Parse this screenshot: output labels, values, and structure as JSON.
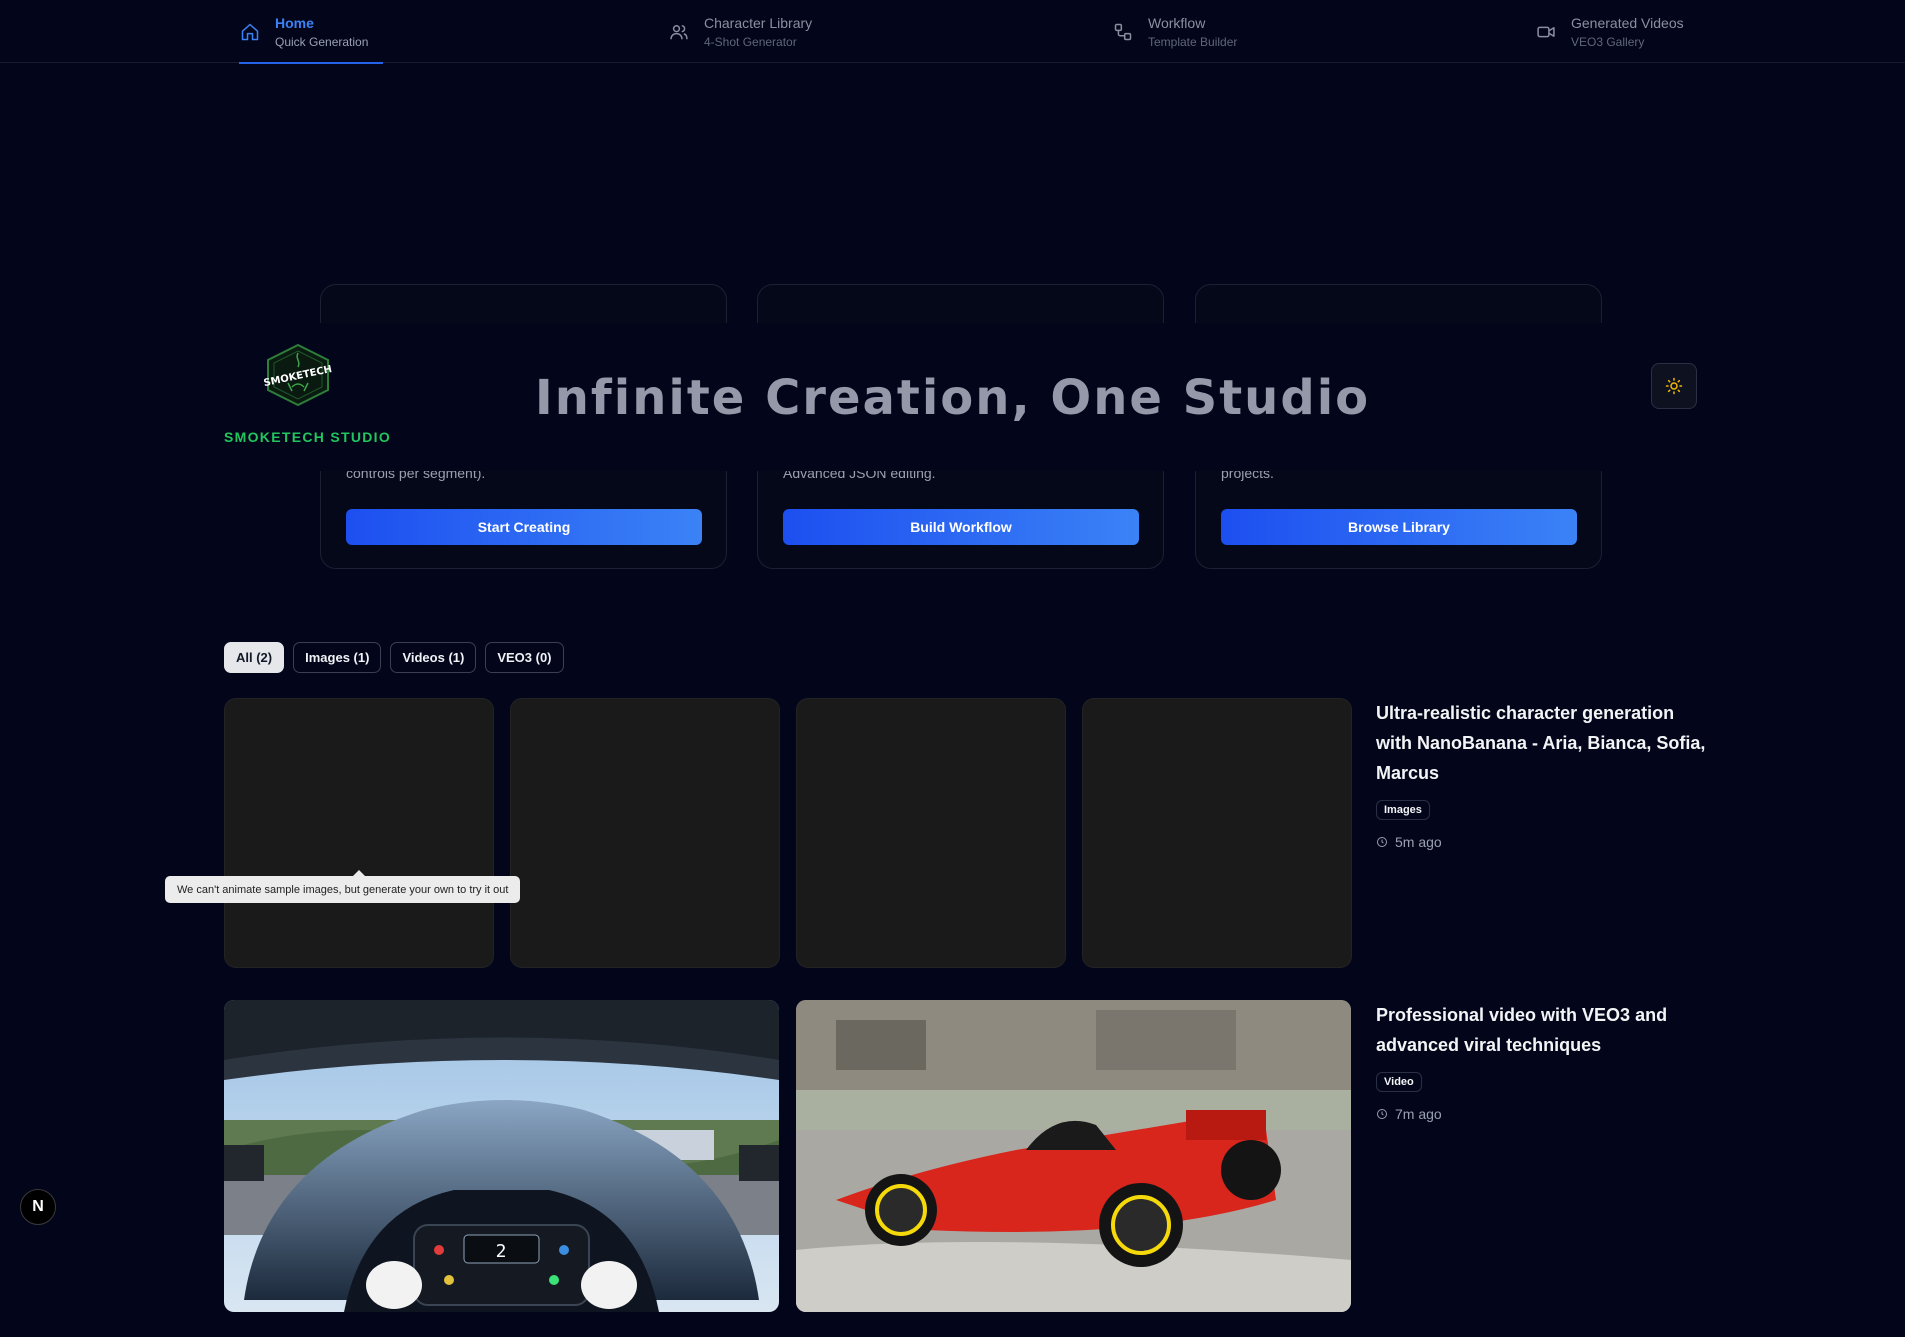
{
  "nav": [
    {
      "label": "Home",
      "sub": "Quick Generation",
      "icon": "home-icon",
      "active": true
    },
    {
      "label": "Character Library",
      "sub": "4-Shot Generator",
      "icon": "users-icon"
    },
    {
      "label": "Workflow",
      "sub": "Template Builder",
      "icon": "workflow-icon"
    },
    {
      "label": "Generated Videos",
      "sub": "VEO3 Gallery",
      "icon": "video-icon"
    }
  ],
  "brand": {
    "name": "SMOKETECH STUDIO",
    "logo_text": "SMOKETECH",
    "color": "#22c55e"
  },
  "hero": {
    "title": "Infinite Creation, One Studio"
  },
  "cards": [
    {
      "desc": "controls per segment).",
      "cta": "Start Creating"
    },
    {
      "desc": "Advanced JSON editing.",
      "cta": "Build Workflow"
    },
    {
      "desc": "projects.",
      "cta": "Browse Library"
    }
  ],
  "filters": [
    {
      "label": "All (2)",
      "active": true
    },
    {
      "label": "Images (1)"
    },
    {
      "label": "Videos (1)"
    },
    {
      "label": "VEO3 (0)"
    }
  ],
  "entries": [
    {
      "title": "Ultra-realistic character generation with NanoBanana - Aria, Bianca, Sofia, Marcus",
      "badge": "Images",
      "time": "5m ago"
    },
    {
      "title": "Professional video with VEO3 and advanced viral techniques",
      "badge": "Video",
      "time": "7m ago"
    }
  ],
  "tooltip": "We can't animate sample images, but generate your own to try it out",
  "cockpit_gear": "2",
  "dev_badge": "N",
  "colors": {
    "accent": "#2563eb",
    "background": "#03061a",
    "brand": "#22c55e",
    "toggle_icon": "#f5b800"
  }
}
